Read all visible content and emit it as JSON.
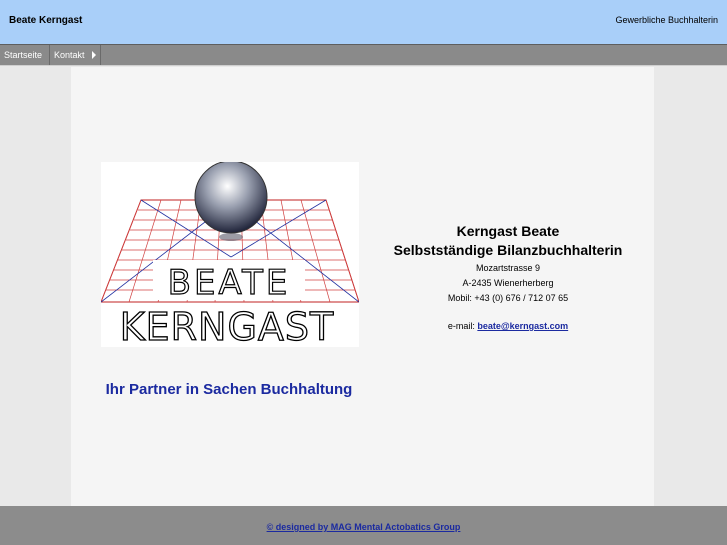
{
  "header": {
    "site_title": "Beate Kerngast",
    "tagline": "Gewerbliche Buchhalterin"
  },
  "nav": {
    "items": [
      {
        "label": "Startseite"
      },
      {
        "label": "Kontakt"
      }
    ]
  },
  "main": {
    "logo": {
      "line1": "BEATE",
      "line2": "KERNGAST"
    },
    "slogan": "Ihr Partner in Sachen Buchhaltung",
    "contact": {
      "name": "Kerngast Beate",
      "role": "Selbstständige Bilanzbuchhalterin",
      "street": "Mozartstrasse 9",
      "city": "A-2435 Wienerherberg",
      "phone": "Mobil: +43 (0) 676 / 712 07 65",
      "email_label": "e-mail:",
      "email": "beate@kerngast.com"
    }
  },
  "footer": {
    "credit": "© designed by MAG Mental Actobatics Group"
  },
  "colors": {
    "header_bg": "#a9cff9",
    "nav_bg": "#8a8a8a",
    "link": "#1b2aa0",
    "footer_bg": "#8c8c8c"
  }
}
